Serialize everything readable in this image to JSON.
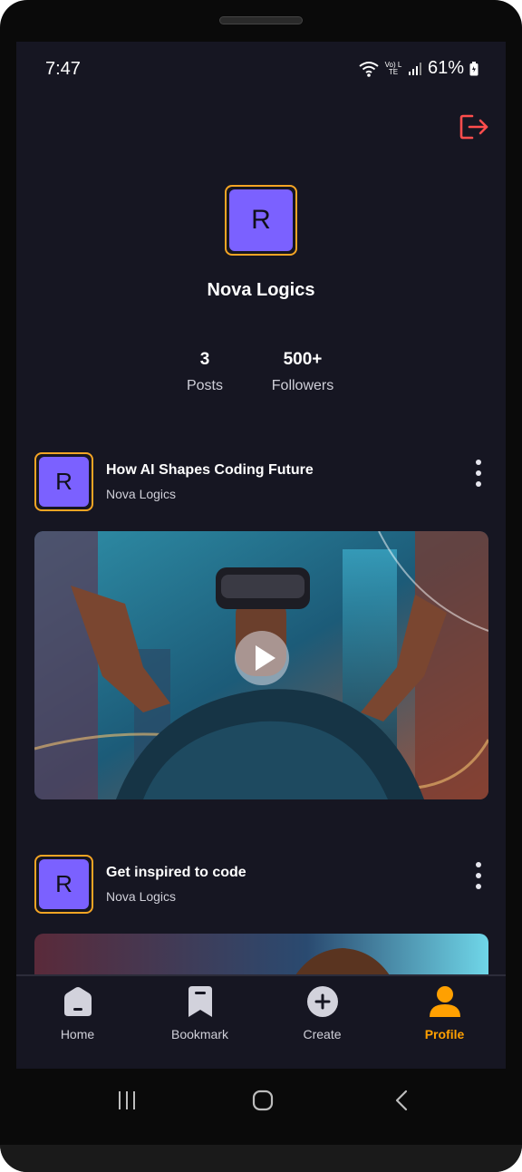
{
  "status_bar": {
    "time": "7:47",
    "battery": "61%",
    "network": "Vo) LTE"
  },
  "profile": {
    "avatar_initial": "R",
    "name": "Nova Logics"
  },
  "stats": [
    {
      "value": "3",
      "label": "Posts"
    },
    {
      "value": "500+",
      "label": "Followers"
    }
  ],
  "posts": [
    {
      "avatar_initial": "R",
      "title": "How AI Shapes Coding Future",
      "author": "Nova Logics",
      "has_video": true
    },
    {
      "avatar_initial": "R",
      "title": "Get inspired to code",
      "author": "Nova Logics",
      "has_video": false
    }
  ],
  "tabs": [
    {
      "label": "Home",
      "icon": "home-icon"
    },
    {
      "label": "Bookmark",
      "icon": "bookmark-icon"
    },
    {
      "label": "Create",
      "icon": "plus-icon"
    },
    {
      "label": "Profile",
      "icon": "profile-icon",
      "active": true
    }
  ],
  "colors": {
    "background": "#161622",
    "accent": "#ffa001",
    "avatar": "#7b61ff",
    "logout": "#ff4d4d"
  }
}
